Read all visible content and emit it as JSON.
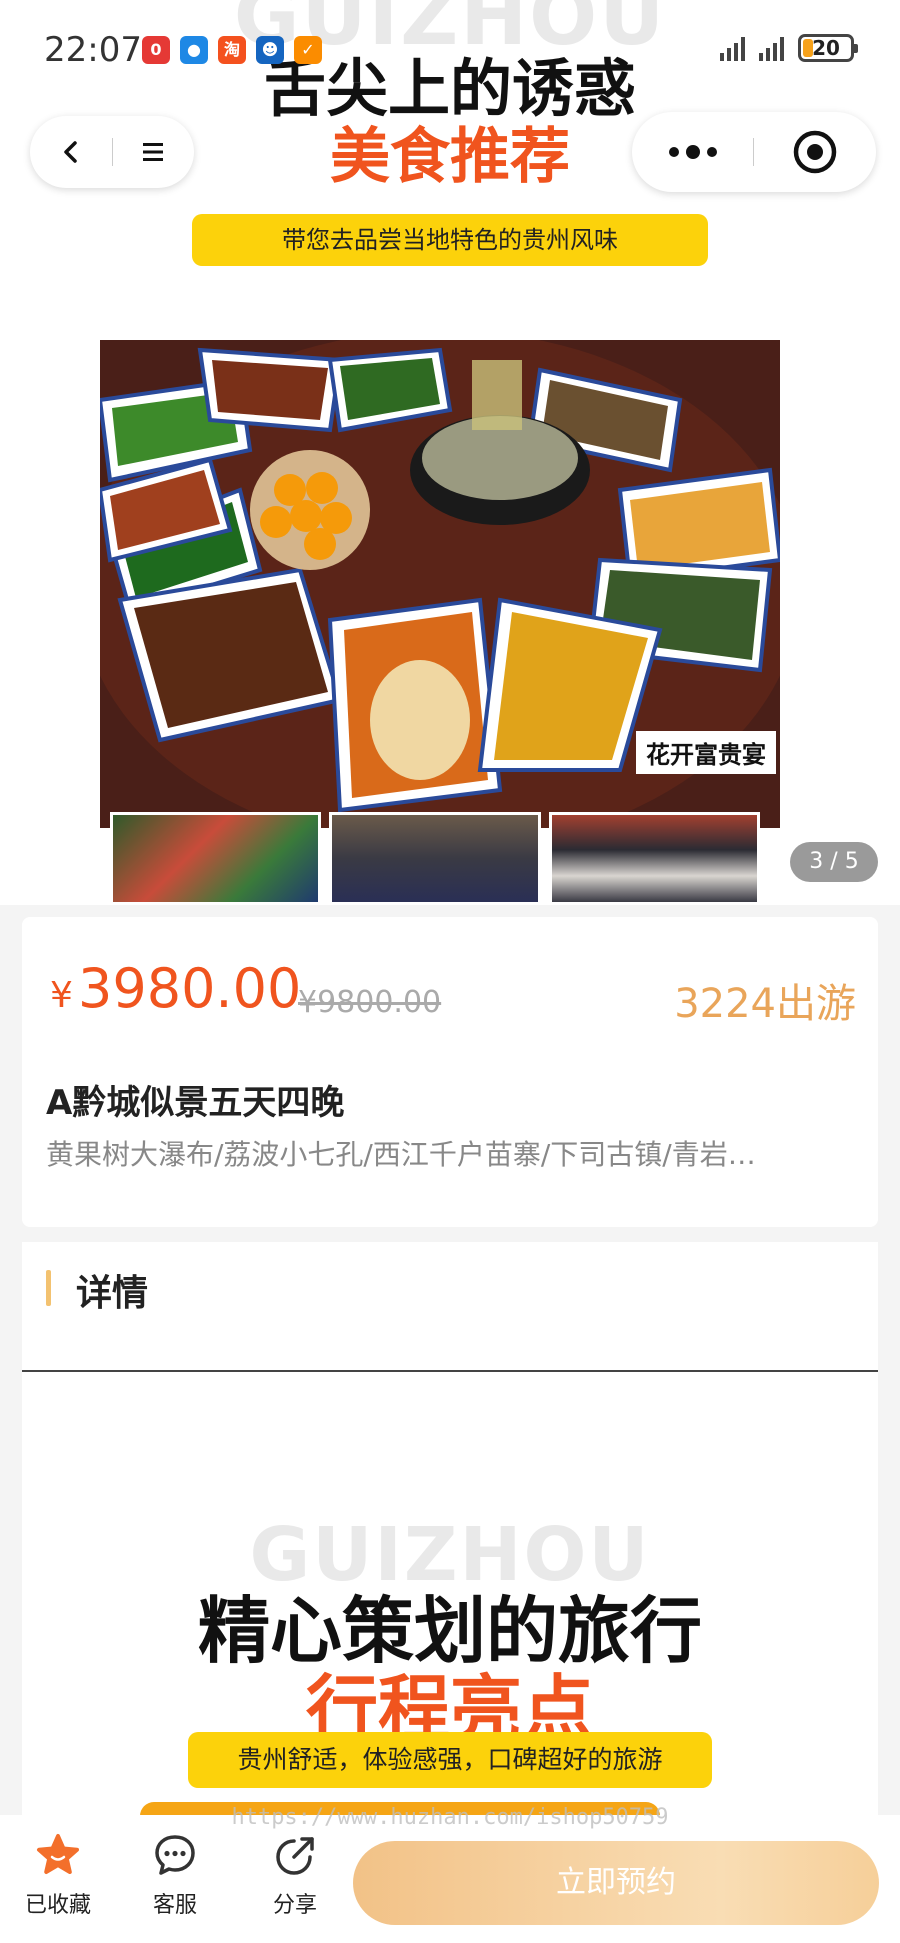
{
  "status_bar": {
    "time": "22:07",
    "battery": "20",
    "apps": [
      {
        "icon": "red-app-icon",
        "color": "#e53935",
        "glyph": "0"
      },
      {
        "icon": "message-app-icon",
        "color": "#1e88e5",
        "glyph": "●"
      },
      {
        "icon": "taobao-app-icon",
        "color": "#f4511e",
        "glyph": "淘"
      },
      {
        "icon": "robot-app-icon",
        "color": "#1565c0",
        "glyph": "☻"
      },
      {
        "icon": "orange-app-icon",
        "color": "#fb8c00",
        "glyph": "✓"
      }
    ]
  },
  "hero": {
    "watermark": "GUIZHOU",
    "title": "舌尖上的诱惑",
    "subtitle": "美食推荐",
    "banner": "带您去品尝当地特色的贵州风味",
    "photo_caption": "花开富贵宴",
    "page_indicator": "3 / 5"
  },
  "product": {
    "currency": "¥",
    "price": "3980.00",
    "original_price": "¥9800.00",
    "travelers": "3224出游",
    "title": "A黔城似景五天四晚",
    "subtitle": "黄果树大瀑布/荔波小七孔/西江千户苗寨/下司古镇/青岩…"
  },
  "details": {
    "section_title": "详情",
    "watermark": "GUIZHOU",
    "title": "精心策划的旅行",
    "subtitle": "行程亮点",
    "banner": "贵州舒适，体验感强，口碑超好的旅游"
  },
  "footer": {
    "watermark": "https://www.huzhan.com/ishop50759",
    "favorite_label": "已收藏",
    "service_label": "客服",
    "share_label": "分享",
    "book_label": "立即预约"
  },
  "colors": {
    "accent_orange": "#f0541e",
    "gold": "#e9a55a",
    "banner_yellow": "#fcd20b"
  }
}
